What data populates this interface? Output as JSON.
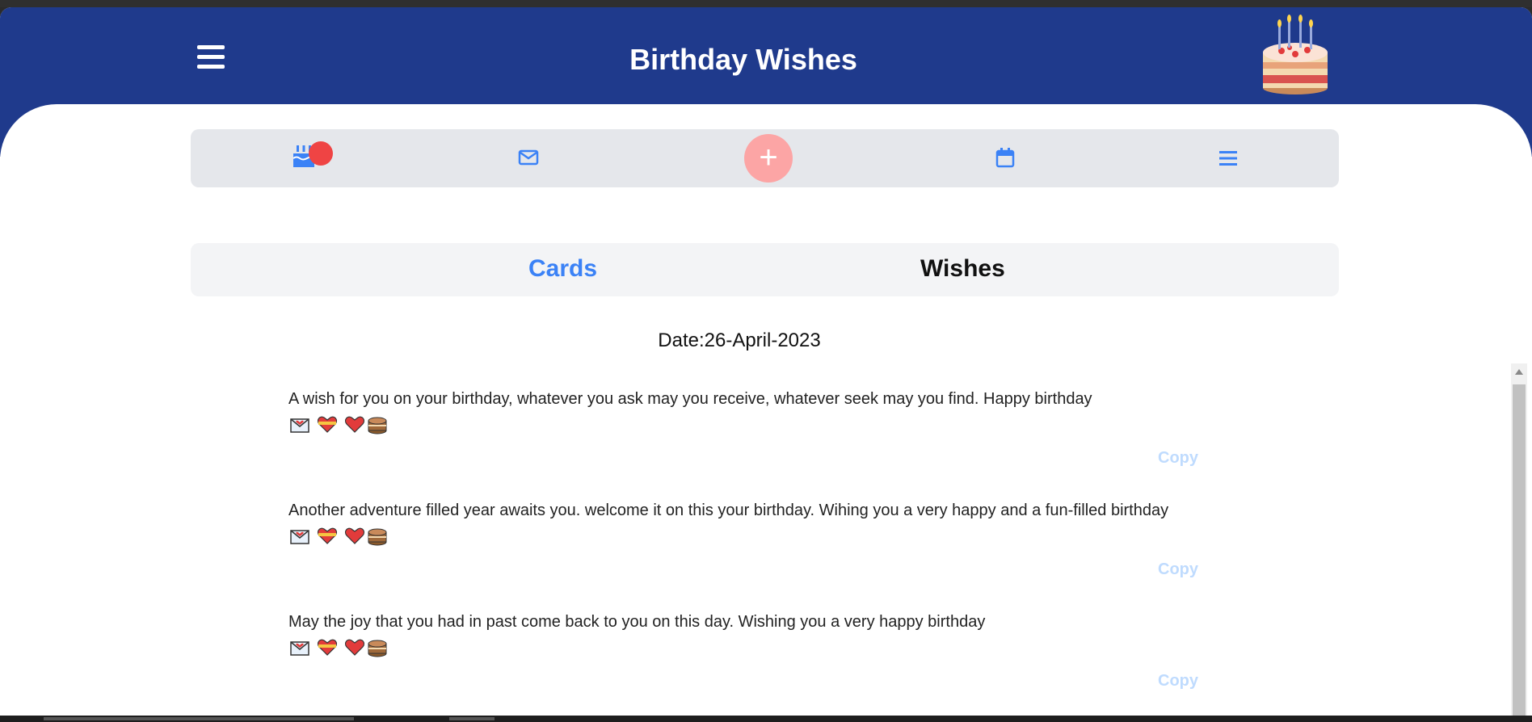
{
  "header": {
    "title": "Birthday Wishes"
  },
  "navbar": {
    "items": [
      "birthday-cake-icon",
      "envelope-icon",
      "plus-icon",
      "calendar-icon",
      "list-icon"
    ],
    "add_label": "+",
    "accent_color": "#3b82f6",
    "badge_color": "#ef4444"
  },
  "tabs": {
    "cards": "Cards",
    "wishes": "Wishes",
    "active": "Wishes"
  },
  "date_label": "Date:26-April-2023",
  "wishes": [
    {
      "text": "A wish for you on your birthday, whatever you ask may you receive, whatever seek may you find. Happy birthday",
      "emojis": [
        "love-letter-icon",
        "heart-ribbon-icon",
        "red-heart-icon",
        "cake-icon"
      ],
      "copy": "Copy"
    },
    {
      "text": "Another adventure filled year awaits you. welcome it on this your birthday. Wihing you a very happy and a fun-filled birthday",
      "emojis": [
        "love-letter-icon",
        "heart-ribbon-icon",
        "red-heart-icon",
        "cake-icon"
      ],
      "copy": "Copy"
    },
    {
      "text": "May the joy that you had in past come back to you on this day. Wishing you a very happy birthday",
      "emojis": [
        "love-letter-icon",
        "heart-ribbon-icon",
        "red-heart-icon",
        "cake-icon"
      ],
      "copy": "Copy"
    }
  ],
  "colors": {
    "header_bg": "#1f3a8c",
    "copy_color": "#bfdbfe",
    "fab_color": "#fca5a5"
  }
}
